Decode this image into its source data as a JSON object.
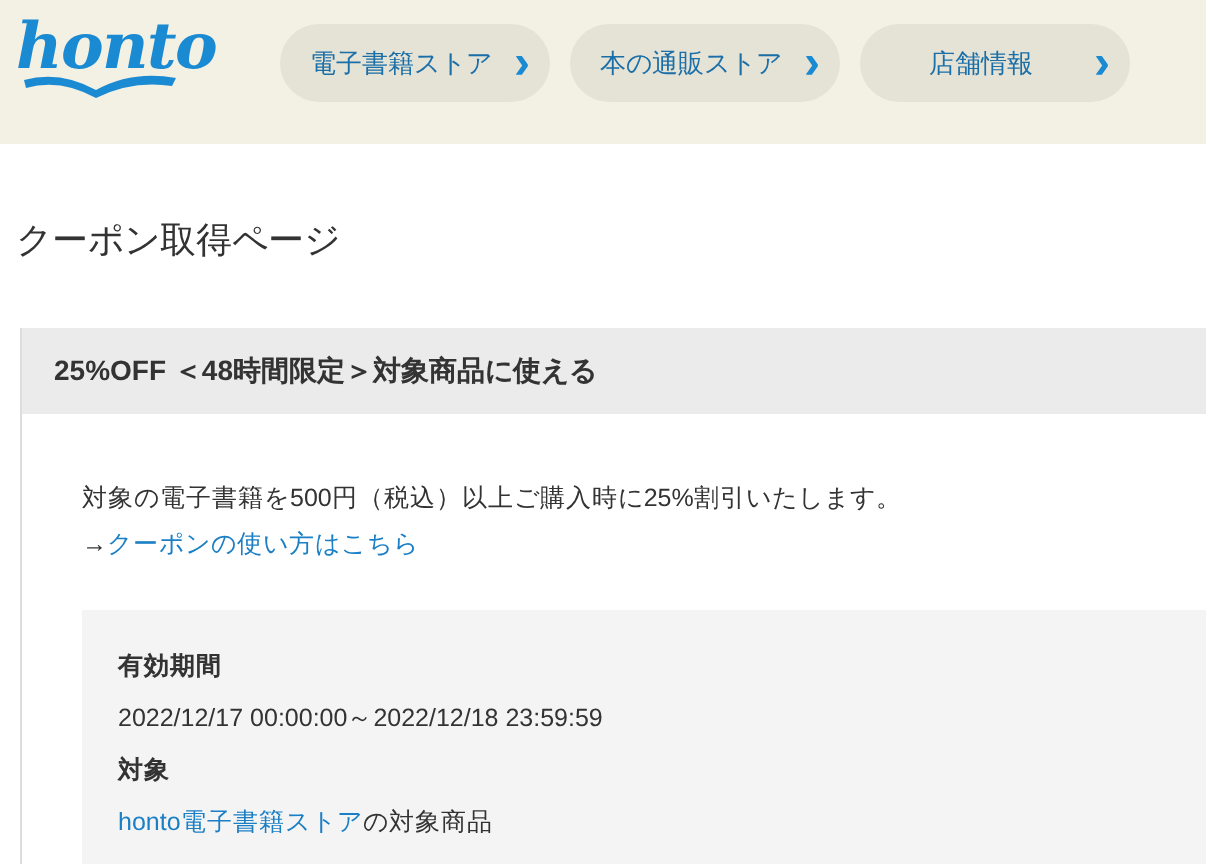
{
  "header": {
    "logo": "honto",
    "nav": [
      {
        "label": "電子書籍ストア",
        "arrow": "›"
      },
      {
        "label": "本の通販ストア",
        "arrow": "›"
      },
      {
        "label": "店舗情報",
        "arrow": "›"
      }
    ]
  },
  "page_title": "クーポン取得ページ",
  "coupon": {
    "title": "25%OFF ＜48時間限定＞対象商品に使える",
    "description": "対象の電子書籍を500円（税込）以上ご購入時に25%割引いたします。",
    "guide_prefix": "→",
    "guide_link": "クーポンの使い方はこちら",
    "details": [
      {
        "label": "有効期間",
        "value": "2022/12/17 00:00:00～2022/12/18 23:59:59"
      },
      {
        "label": "対象",
        "link": "honto電子書籍ストア",
        "value": "の対象商品"
      }
    ]
  }
}
